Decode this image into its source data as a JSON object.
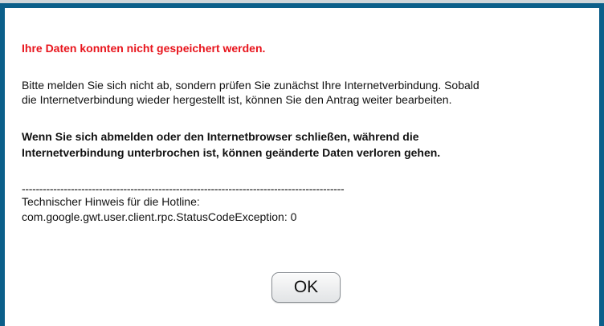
{
  "dialog": {
    "error_title": "Ihre Daten konnten nicht gespeichert werden.",
    "info_line1": "Bitte melden Sie sich nicht ab, sondern prüfen Sie zunächst Ihre Internetverbindung. Sobald",
    "info_line2": "die Internetverbindung wieder hergestellt ist, können Sie den Antrag weiter bearbeiten.",
    "warn_line1": "Wenn Sie sich abmelden oder den Internetbrowser schließen, während die",
    "warn_line2": "Internetverbindung unterbrochen ist, können geänderte Daten verloren gehen.",
    "separator": "--------------------------------------------------------------------------------------------",
    "hint_label": "Technischer Hinweis für die Hotline:",
    "hint_code": "com.google.gwt.user.client.rpc.StatusCodeException: 0",
    "ok_label": "OK"
  },
  "colors": {
    "border": "#0b5f8a",
    "error": "#e8141c",
    "text": "#111111"
  }
}
